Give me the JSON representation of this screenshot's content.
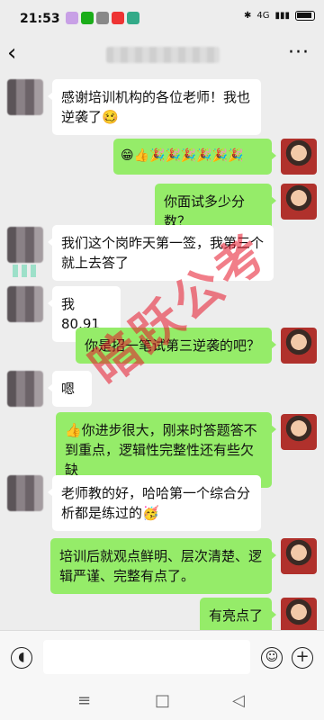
{
  "status_bar": {
    "time": "21:53",
    "right_text": "4G"
  },
  "nav": {
    "back_label": "‹",
    "more_label": "···"
  },
  "messages": [
    {
      "side": "left",
      "text": "感谢培训机构的各位老师！我也逆袭了🥴"
    },
    {
      "side": "right",
      "text": "😁👍🎉🎉🎉🎉🎉🎉"
    },
    {
      "side": "right",
      "text": "你面试多少分数？"
    },
    {
      "side": "left",
      "text": "我们这个岗昨天第一签，我第三个就上去答了"
    },
    {
      "side": "left",
      "text": "我 80.91"
    },
    {
      "side": "right",
      "text": "你是招一笔试第三逆袭的吧？"
    },
    {
      "side": "left",
      "text": "嗯"
    },
    {
      "side": "right",
      "text": "👍你进步很大，刚来时答题答不到重点，逻辑性完整性还有些欠缺"
    },
    {
      "side": "left",
      "text": "老师教的好，哈哈第一个综合分析都是练过的🥳"
    },
    {
      "side": "right",
      "text": "培训后就观点鲜明、层次清楚、逻辑严谨、完整有点了。"
    },
    {
      "side": "right",
      "text": "有亮点了"
    }
  ],
  "watermark": "暗跃公考",
  "input_bar": {
    "voice_icon": "voice-icon",
    "emoji_icon": "emoji-icon",
    "plus_label": "+"
  },
  "system_nav": {
    "menu": "≡",
    "home": "□",
    "back": "◁"
  }
}
